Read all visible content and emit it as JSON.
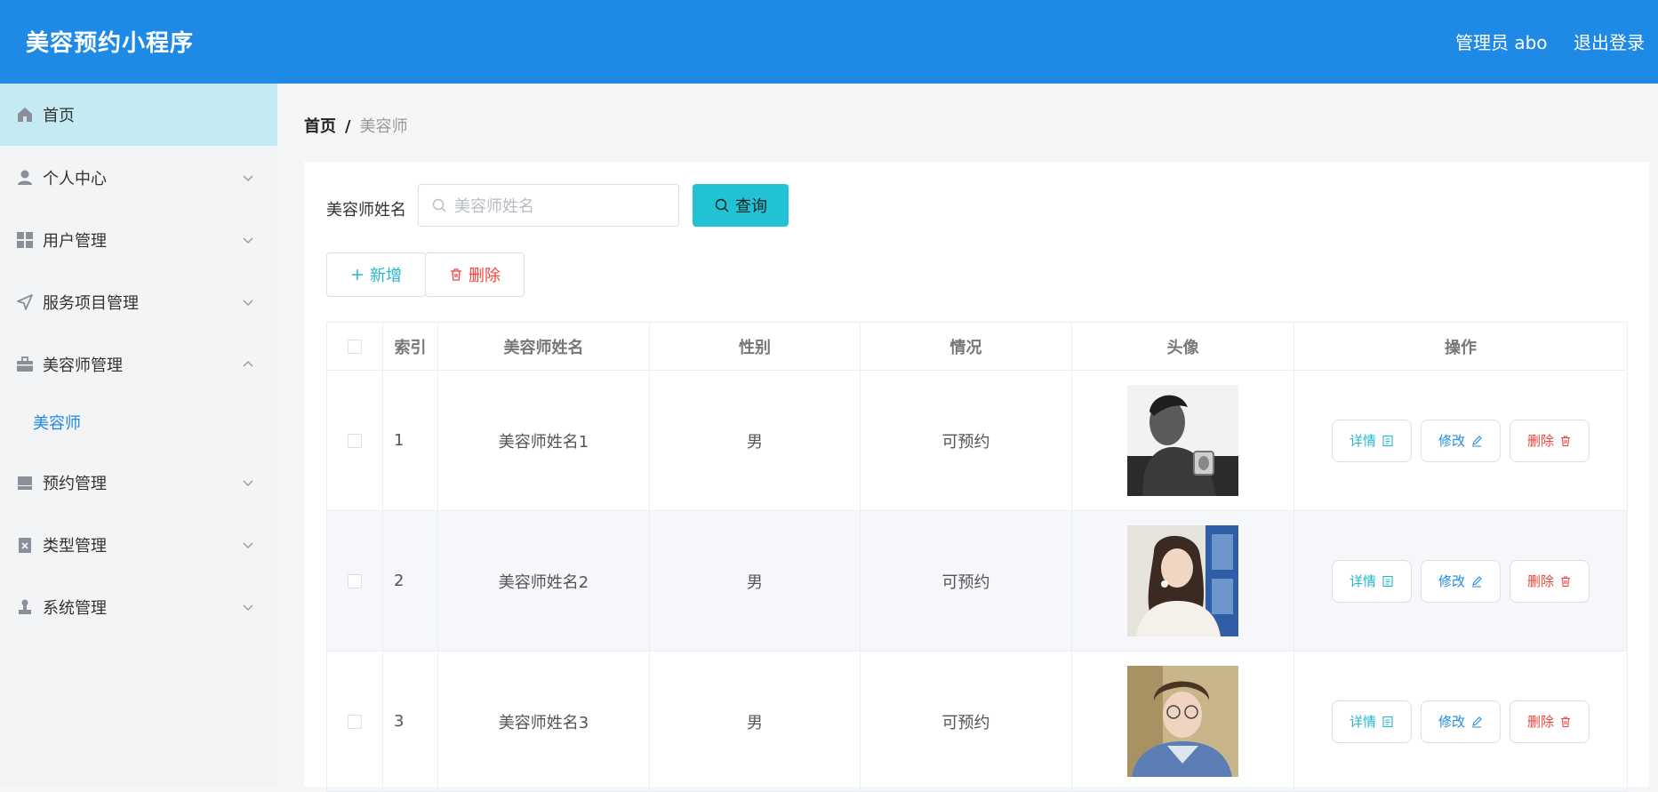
{
  "header": {
    "title": "美容预约小程序",
    "user": "管理员 abo",
    "logout": "退出登录"
  },
  "sidebar": {
    "items": [
      {
        "label": "首页",
        "icon": "home-icon"
      },
      {
        "label": "个人中心",
        "icon": "user-icon"
      },
      {
        "label": "用户管理",
        "icon": "grid-icon"
      },
      {
        "label": "服务项目管理",
        "icon": "send-icon"
      },
      {
        "label": "美容师管理",
        "icon": "briefcase-icon"
      },
      {
        "label": "预约管理",
        "icon": "inbox-icon"
      },
      {
        "label": "类型管理",
        "icon": "clipboard-icon"
      },
      {
        "label": "系统管理",
        "icon": "stamp-icon"
      }
    ],
    "sub_item": "美容师"
  },
  "breadcrumb": {
    "home": "首页",
    "separator": "/",
    "current": "美容师"
  },
  "search": {
    "label": "美容师姓名",
    "placeholder": "美容师姓名",
    "button": "查询"
  },
  "actions": {
    "add": "新增",
    "delete": "删除"
  },
  "table": {
    "headers": [
      "索引",
      "美容师姓名",
      "性别",
      "情况",
      "头像",
      "操作"
    ],
    "rows": [
      {
        "index": "1",
        "name": "美容师姓名1",
        "gender": "男",
        "status": "可预约"
      },
      {
        "index": "2",
        "name": "美容师姓名2",
        "gender": "男",
        "status": "可预约"
      },
      {
        "index": "3",
        "name": "美容师姓名3",
        "gender": "男",
        "status": "可预约"
      }
    ],
    "row_actions": {
      "detail": "详情",
      "edit": "修改",
      "delete": "删除"
    }
  },
  "colors": {
    "header": "#1f8ae5",
    "active_nav": "#c5eaf4",
    "query_button": "#21c2d6",
    "danger": "#f0443c"
  }
}
